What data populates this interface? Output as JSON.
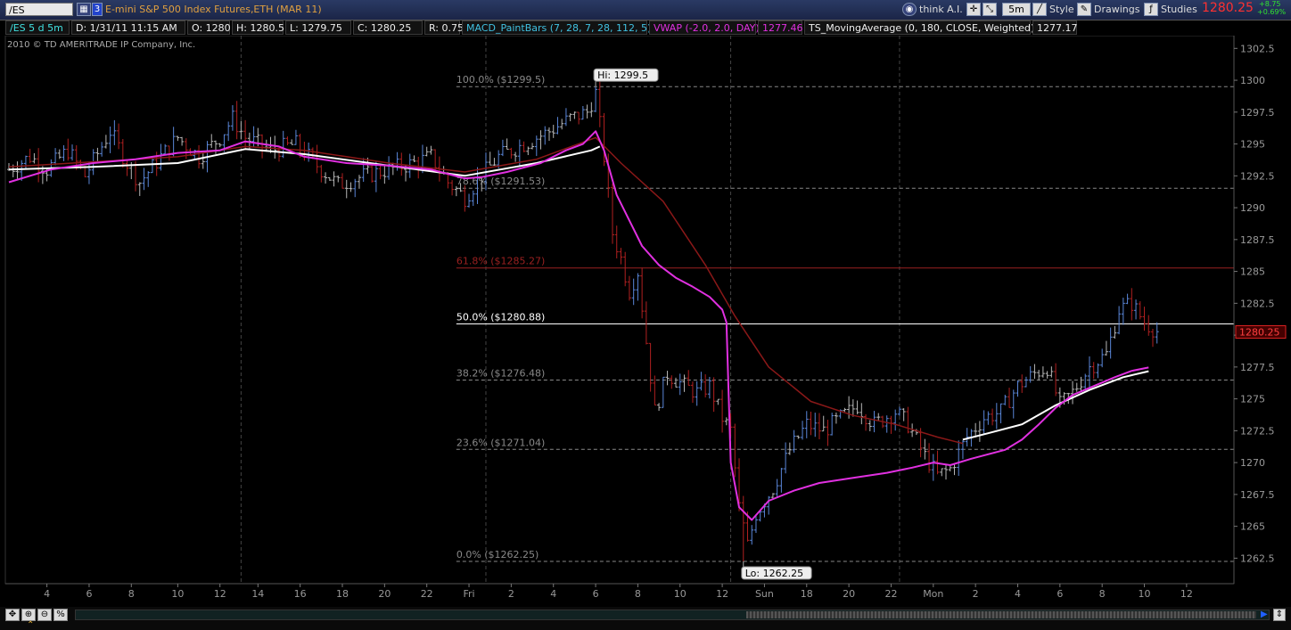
{
  "toolbar": {
    "symbol": "/ES",
    "link_number": "3",
    "description": "E-mini S&P 500 Index Futures,ETH (MAR 11)",
    "think_ai": "think A.I.",
    "timeframe": "5m",
    "style": "Style",
    "drawings": "Drawings",
    "studies": "Studies",
    "last_price": "1280.25",
    "change": "+8.75",
    "change_pct": "+0.69%"
  },
  "info": {
    "symbol_period": "/ES 5 d 5m",
    "date": "D: 1/31/11 11:15 AM",
    "open": "O: 1280",
    "high": "H: 1280.5",
    "low": "L: 1279.75",
    "close": "C: 1280.25",
    "range": "R: 0.75",
    "y_label": "Y:",
    "study_macd": "MACD_PaintBars (7, 28, 7, 28, 112, 5)",
    "study_vwap": "VWAP (-2.0, 2.0, DAY)",
    "vwap_value": "1277.46",
    "study_ma": "TS_MovingAverage (0, 180, CLOSE, Weighted)",
    "ma_value": "1277.17"
  },
  "copyright": "2010 © TD AMERITRADE IP Company, Inc.",
  "colors": {
    "bull": "#5a86d8",
    "bear": "#b02020",
    "neutral": "#b8b8b8",
    "vwap": "#e030e0",
    "ma_red": "#8a1818",
    "ma_white": "#ffffff",
    "fib_active": "#ffffff",
    "fib_muted": "#888888",
    "fib_red": "#9a2020"
  },
  "chart_data": {
    "type": "line",
    "y_range": [
      1260.5,
      1303.5
    ],
    "y_ticks": [
      "1302.5",
      "1300",
      "1297.5",
      "1295",
      "1292.5",
      "1290",
      "1287.5",
      "1285",
      "1282.5",
      "1280",
      "1277.5",
      "1275",
      "1272.5",
      "1270",
      "1267.5",
      "1265",
      "1262.5"
    ],
    "y_tick_values": [
      1302.5,
      1300,
      1297.5,
      1295,
      1292.5,
      1290,
      1287.5,
      1285,
      1282.5,
      1280,
      1277.5,
      1275,
      1272.5,
      1270,
      1267.5,
      1265,
      1262.5
    ],
    "x_ticks": [
      "4",
      "6",
      "8",
      "10",
      "12",
      "14",
      "16",
      "18",
      "20",
      "22",
      "Fri",
      "2",
      "4",
      "6",
      "8",
      "10",
      "12",
      "Sun",
      "18",
      "20",
      "22",
      "Mon",
      "2",
      "4",
      "6",
      "8",
      "10",
      "12"
    ],
    "x_tick_index": [
      9,
      19,
      29,
      40,
      50,
      59,
      69,
      79,
      89,
      99,
      109,
      119,
      129,
      139,
      149,
      159,
      169,
      179,
      189,
      199,
      209,
      219,
      229,
      239,
      249,
      259,
      269,
      279
    ],
    "session_dividers": [
      55,
      113,
      171,
      211
    ],
    "n_bars": 286,
    "fib_levels": [
      {
        "label": "100.0% ($1299.5)",
        "value": 1299.5,
        "style": "muted"
      },
      {
        "label": "78.6% ($1291.53)",
        "value": 1291.53,
        "style": "muted"
      },
      {
        "label": "61.8% ($1285.27)",
        "value": 1285.27,
        "style": "red"
      },
      {
        "label": "50.0% ($1280.88)",
        "value": 1280.88,
        "style": "active"
      },
      {
        "label": "38.2% ($1276.48)",
        "value": 1276.48,
        "style": "muted"
      },
      {
        "label": "23.6% ($1271.04)",
        "value": 1271.04,
        "style": "muted"
      },
      {
        "label": "0.0% ($1262.25)",
        "value": 1262.25,
        "style": "muted"
      }
    ],
    "hi_label": "Hi: 1299.5",
    "lo_label": "Lo: 1262.25",
    "hi_index": 139,
    "lo_index": 174,
    "price_path": [
      [
        0,
        1293.0
      ],
      [
        5,
        1294.0
      ],
      [
        9,
        1293.0
      ],
      [
        14,
        1294.5
      ],
      [
        18,
        1292.5
      ],
      [
        24,
        1296.0
      ],
      [
        28,
        1293.5
      ],
      [
        31,
        1292.0
      ],
      [
        36,
        1294.0
      ],
      [
        40,
        1295.5
      ],
      [
        45,
        1294.0
      ],
      [
        50,
        1295.5
      ],
      [
        53,
        1297.0
      ],
      [
        56,
        1295.5
      ],
      [
        62,
        1294.5
      ],
      [
        68,
        1295.0
      ],
      [
        74,
        1293.0
      ],
      [
        78,
        1291.8
      ],
      [
        84,
        1292.5
      ],
      [
        90,
        1293.0
      ],
      [
        96,
        1293.5
      ],
      [
        100,
        1294.0
      ],
      [
        104,
        1292.0
      ],
      [
        108,
        1290.8
      ],
      [
        112,
        1292.5
      ],
      [
        116,
        1294.0
      ],
      [
        122,
        1295.0
      ],
      [
        128,
        1296.0
      ],
      [
        133,
        1297.0
      ],
      [
        137,
        1297.5
      ],
      [
        139,
        1299.0
      ],
      [
        141,
        1294.0
      ],
      [
        143,
        1288.0
      ],
      [
        145,
        1286.0
      ],
      [
        147,
        1283.5
      ],
      [
        149,
        1285.0
      ],
      [
        151,
        1279.5
      ],
      [
        153,
        1274.0
      ],
      [
        156,
        1277.0
      ],
      [
        160,
        1276.0
      ],
      [
        163,
        1275.5
      ],
      [
        166,
        1276.0
      ],
      [
        169,
        1273.5
      ],
      [
        171,
        1272.5
      ],
      [
        173,
        1266.5
      ],
      [
        175,
        1263.5
      ],
      [
        177,
        1266.0
      ],
      [
        181,
        1268.0
      ],
      [
        185,
        1271.0
      ],
      [
        189,
        1273.0
      ],
      [
        193,
        1272.5
      ],
      [
        197,
        1273.5
      ],
      [
        201,
        1274.5
      ],
      [
        205,
        1273.0
      ],
      [
        210,
        1274.0
      ],
      [
        213,
        1273.0
      ],
      [
        217,
        1270.5
      ],
      [
        220,
        1269.0
      ],
      [
        223,
        1269.5
      ],
      [
        227,
        1272.0
      ],
      [
        231,
        1273.5
      ],
      [
        235,
        1274.0
      ],
      [
        239,
        1276.0
      ],
      [
        243,
        1277.0
      ],
      [
        246,
        1277.5
      ],
      [
        249,
        1274.5
      ],
      [
        252,
        1275.5
      ],
      [
        256,
        1277.5
      ],
      [
        260,
        1278.5
      ],
      [
        263,
        1282.0
      ],
      [
        266,
        1282.5
      ],
      [
        269,
        1281.0
      ],
      [
        272,
        1280.3
      ]
    ],
    "vwap_path": [
      [
        0,
        1292.0
      ],
      [
        10,
        1293.0
      ],
      [
        20,
        1293.5
      ],
      [
        30,
        1293.8
      ],
      [
        40,
        1294.3
      ],
      [
        50,
        1294.5
      ],
      [
        56,
        1295.2
      ],
      [
        64,
        1294.8
      ],
      [
        70,
        1294.0
      ],
      [
        80,
        1293.5
      ],
      [
        90,
        1293.3
      ],
      [
        100,
        1293.0
      ],
      [
        108,
        1292.3
      ],
      [
        112,
        1292.4
      ],
      [
        118,
        1292.8
      ],
      [
        126,
        1293.5
      ],
      [
        132,
        1294.5
      ],
      [
        136,
        1295.0
      ],
      [
        139,
        1296.0
      ],
      [
        141,
        1294.5
      ],
      [
        144,
        1291.0
      ],
      [
        147,
        1289.0
      ],
      [
        150,
        1287.0
      ],
      [
        154,
        1285.5
      ],
      [
        158,
        1284.5
      ],
      [
        162,
        1283.8
      ],
      [
        166,
        1283.0
      ],
      [
        169,
        1282.0
      ],
      [
        170,
        1281.0
      ],
      [
        171,
        1270.0
      ],
      [
        173,
        1266.5
      ],
      [
        176,
        1265.5
      ],
      [
        180,
        1267.0
      ],
      [
        186,
        1267.8
      ],
      [
        192,
        1268.4
      ],
      [
        200,
        1268.8
      ],
      [
        208,
        1269.2
      ],
      [
        214,
        1269.6
      ],
      [
        219,
        1270.0
      ],
      [
        223,
        1269.8
      ],
      [
        228,
        1270.3
      ],
      [
        236,
        1271.0
      ],
      [
        240,
        1271.8
      ],
      [
        244,
        1273.0
      ],
      [
        248,
        1274.3
      ],
      [
        252,
        1275.3
      ],
      [
        257,
        1276.0
      ],
      [
        262,
        1276.7
      ],
      [
        266,
        1277.2
      ],
      [
        270,
        1277.46
      ]
    ],
    "ma_red_path": [
      [
        0,
        1293.2
      ],
      [
        20,
        1293.6
      ],
      [
        40,
        1294.0
      ],
      [
        56,
        1294.8
      ],
      [
        70,
        1294.5
      ],
      [
        90,
        1293.5
      ],
      [
        108,
        1292.8
      ],
      [
        125,
        1293.8
      ],
      [
        139,
        1295.5
      ],
      [
        145,
        1293.5
      ],
      [
        155,
        1290.5
      ],
      [
        165,
        1285.5
      ],
      [
        172,
        1281.5
      ],
      [
        180,
        1277.5
      ],
      [
        190,
        1274.8
      ],
      [
        200,
        1273.7
      ],
      [
        210,
        1273.0
      ],
      [
        220,
        1272.0
      ],
      [
        226,
        1271.5
      ]
    ],
    "ma_white_path": [
      [
        0,
        1293.0
      ],
      [
        20,
        1293.2
      ],
      [
        40,
        1293.5
      ],
      [
        56,
        1294.6
      ],
      [
        70,
        1294.2
      ],
      [
        90,
        1293.3
      ],
      [
        108,
        1292.5
      ],
      [
        125,
        1293.5
      ],
      [
        138,
        1294.5
      ],
      [
        140,
        1294.8
      ],
      [
        226,
        1271.8
      ],
      [
        232,
        1272.3
      ],
      [
        240,
        1273.0
      ],
      [
        248,
        1274.5
      ],
      [
        256,
        1275.7
      ],
      [
        264,
        1276.7
      ],
      [
        270,
        1277.17
      ]
    ]
  }
}
